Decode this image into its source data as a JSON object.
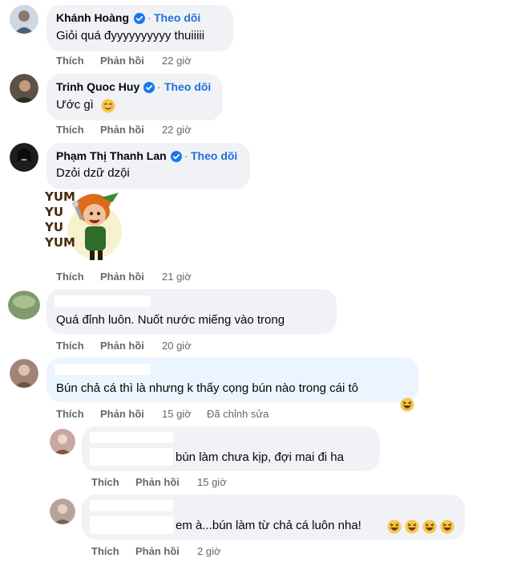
{
  "colors": {
    "bubble": "#f0f2f5",
    "bubble_highlight": "#ebf5ff",
    "link": "#216fdb",
    "meta": "#65676b",
    "emoji": "#f7c64a"
  },
  "icons": {
    "verified": "verified-badge-icon",
    "emoji_grin": "grinning-squinting-face-icon",
    "emoji_smile": "smiling-face-icon"
  },
  "sticker": {
    "lines": [
      "YUM",
      "YU",
      "YU",
      "YUM"
    ]
  },
  "comments": [
    {
      "name": "Khánh Hoàng",
      "follow": "Theo dõi",
      "text": "Giỏi quá đyyyyyyyyyy thuiiiii",
      "like": "Thích",
      "reply": "Phản hồi",
      "time": "22 giờ"
    },
    {
      "name": "Trinh Quoc Huy",
      "follow": "Theo dõi",
      "text": "Ước gì",
      "like": "Thích",
      "reply": "Phản hồi",
      "time": "22 giờ"
    },
    {
      "name": "Phạm Thị Thanh Lan",
      "follow": "Theo dõi",
      "text": "Dzỏi dzữ dzội",
      "like": "Thích",
      "reply": "Phản hồi",
      "time": "21 giờ"
    },
    {
      "text": "Quá đỉnh luôn. Nuốt nước miếng vào trong",
      "like": "Thích",
      "reply": "Phản hồi",
      "time": "20 giờ"
    },
    {
      "text": "Bún chả cá thì là nhưng k thấy cọng bún nào trong cái tô",
      "like": "Thích",
      "reply": "Phản hồi",
      "time": "15 giờ",
      "edited": "Đã chỉnh sửa"
    }
  ],
  "replies": [
    {
      "text": "bún làm chưa kịp, đợi mai đi ha",
      "like": "Thích",
      "reply": "Phản hồi",
      "time": "15 giờ"
    },
    {
      "text": "em à...bún làm từ chả cá luôn nha!",
      "like": "Thích",
      "reply": "Phản hồi",
      "time": "2 giờ"
    }
  ],
  "separator": "·"
}
